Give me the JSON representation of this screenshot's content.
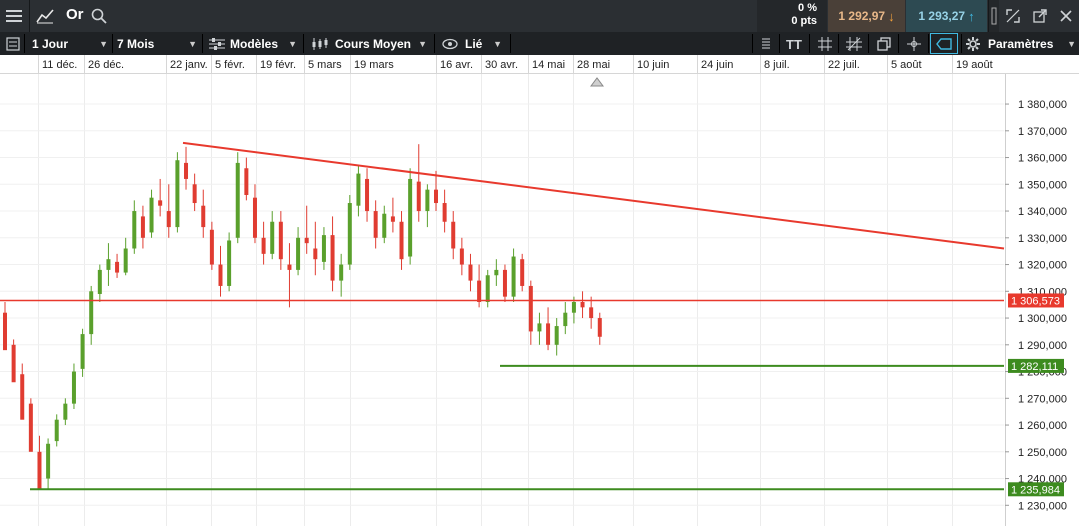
{
  "app": {
    "instrument": "Or",
    "change_pct": "0 %",
    "change_pts": "0 pts",
    "sell_price": "1 292,97",
    "buy_price": "1 293,27",
    "icons": [
      "menu-icon",
      "chart-line-icon",
      "search-icon",
      "collapse-icon",
      "fullscreen-icon",
      "popout-icon",
      "close-icon"
    ]
  },
  "toolbar": {
    "timeframe": "1 Jour",
    "range": "7 Mois",
    "templates": "Modèles",
    "indicator": "Cours Moyen",
    "link": "Lié",
    "settings": "Paramètres"
  },
  "colors": {
    "up": "#5aa02c",
    "down": "#e03c31",
    "resistance": "#e8392d",
    "support": "#3d8b1f"
  },
  "chart_data": {
    "type": "candlestick",
    "x_labels": [
      "11 déc.",
      "26 déc.",
      "22 janv.",
      "5 févr.",
      "19 févr.",
      "5 mars",
      "19 mars",
      "16 avr.",
      "30 avr.",
      "14 mai",
      "28 mai",
      "10 juin",
      "24 juin",
      "8 juil.",
      "22 juil.",
      "5 août",
      "19 août"
    ],
    "y_ticks": [
      "1 380,000",
      "1 370,000",
      "1 360,000",
      "1 350,000",
      "1 340,000",
      "1 330,000",
      "1 320,000",
      "1 310,000",
      "1 300,000",
      "1 290,000",
      "1 280,000",
      "1 270,000",
      "1 260,000",
      "1 250,000",
      "1 240,000",
      "1 230,000"
    ],
    "ylim": [
      1226,
      1386
    ],
    "ohlc": [
      [
        1302,
        1306,
        1290,
        1288
      ],
      [
        1290,
        1292,
        1277,
        1276
      ],
      [
        1279,
        1283,
        1266,
        1262
      ],
      [
        1268,
        1270,
        1253,
        1250
      ],
      [
        1250,
        1256,
        1238,
        1236
      ],
      [
        1240,
        1255,
        1236,
        1253
      ],
      [
        1254,
        1264,
        1252,
        1262
      ],
      [
        1262,
        1270,
        1260,
        1268
      ],
      [
        1268,
        1283,
        1266,
        1280
      ],
      [
        1281,
        1296,
        1278,
        1294
      ],
      [
        1294,
        1312,
        1290,
        1310
      ],
      [
        1309,
        1320,
        1306,
        1318
      ],
      [
        1318,
        1328,
        1312,
        1322
      ],
      [
        1321,
        1324,
        1315,
        1317
      ],
      [
        1317,
        1330,
        1316,
        1326
      ],
      [
        1326,
        1344,
        1324,
        1340
      ],
      [
        1338,
        1342,
        1326,
        1330
      ],
      [
        1332,
        1348,
        1330,
        1345
      ],
      [
        1344,
        1352,
        1338,
        1342
      ],
      [
        1340,
        1350,
        1330,
        1334
      ],
      [
        1334,
        1362,
        1332,
        1359
      ],
      [
        1358,
        1364,
        1348,
        1352
      ],
      [
        1350,
        1354,
        1340,
        1343
      ],
      [
        1342,
        1348,
        1330,
        1334
      ],
      [
        1333,
        1336,
        1318,
        1320
      ],
      [
        1320,
        1327,
        1308,
        1312
      ],
      [
        1312,
        1332,
        1310,
        1329
      ],
      [
        1330,
        1362,
        1328,
        1358
      ],
      [
        1356,
        1360,
        1344,
        1346
      ],
      [
        1345,
        1350,
        1328,
        1330
      ],
      [
        1330,
        1336,
        1320,
        1324
      ],
      [
        1324,
        1340,
        1322,
        1336
      ],
      [
        1336,
        1340,
        1318,
        1322
      ],
      [
        1320,
        1328,
        1304,
        1318
      ],
      [
        1318,
        1334,
        1316,
        1330
      ],
      [
        1330,
        1342,
        1324,
        1328
      ],
      [
        1326,
        1336,
        1316,
        1322
      ],
      [
        1321,
        1334,
        1318,
        1331
      ],
      [
        1331,
        1338,
        1310,
        1314
      ],
      [
        1314,
        1324,
        1308,
        1320
      ],
      [
        1320,
        1346,
        1318,
        1343
      ],
      [
        1342,
        1357,
        1338,
        1354
      ],
      [
        1352,
        1356,
        1336,
        1340
      ],
      [
        1340,
        1344,
        1326,
        1330
      ],
      [
        1330,
        1342,
        1328,
        1339
      ],
      [
        1338,
        1345,
        1332,
        1336
      ],
      [
        1336,
        1340,
        1318,
        1322
      ],
      [
        1323,
        1356,
        1320,
        1352
      ],
      [
        1351,
        1365,
        1336,
        1340
      ],
      [
        1340,
        1350,
        1334,
        1348
      ],
      [
        1348,
        1355,
        1340,
        1343
      ],
      [
        1343,
        1348,
        1332,
        1336
      ],
      [
        1336,
        1340,
        1322,
        1326
      ],
      [
        1326,
        1330,
        1316,
        1320
      ],
      [
        1320,
        1324,
        1310,
        1314
      ],
      [
        1314,
        1320,
        1304,
        1306
      ],
      [
        1306,
        1318,
        1304,
        1316
      ],
      [
        1316,
        1322,
        1312,
        1318
      ],
      [
        1318,
        1320,
        1306,
        1308
      ],
      [
        1308,
        1326,
        1306,
        1323
      ],
      [
        1322,
        1324,
        1310,
        1312
      ],
      [
        1312,
        1314,
        1290,
        1295
      ],
      [
        1295,
        1302,
        1290,
        1298
      ],
      [
        1298,
        1304,
        1288,
        1290
      ],
      [
        1290,
        1300,
        1286,
        1297
      ],
      [
        1297,
        1306,
        1294,
        1302
      ],
      [
        1302,
        1308,
        1298,
        1306
      ],
      [
        1306,
        1310,
        1300,
        1304
      ],
      [
        1304,
        1308,
        1296,
        1300
      ],
      [
        1300,
        1302,
        1290,
        1293
      ]
    ],
    "lines": [
      {
        "label": "trendline",
        "points": [
          [
            "26 déc.",
            1365.5
          ],
          [
            "19 août",
            1326
          ]
        ]
      },
      {
        "label": "resistance",
        "value": 1306.573,
        "tag": "1 306,573"
      },
      {
        "label": "support",
        "value": 1282.111,
        "tag": "1 282,111"
      },
      {
        "label": "support",
        "value": 1235.984,
        "tag": "1 235,984"
      }
    ],
    "grid": true
  }
}
